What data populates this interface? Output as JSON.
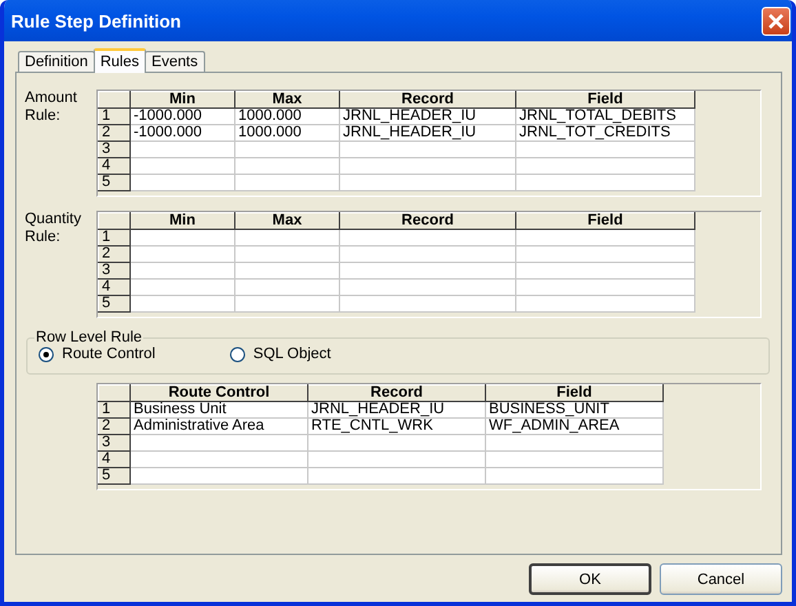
{
  "window": {
    "title": "Rule Step Definition"
  },
  "tabs": [
    {
      "label": "Definition",
      "selected": false
    },
    {
      "label": "Rules",
      "selected": true
    },
    {
      "label": "Events",
      "selected": false
    }
  ],
  "amount_rule": {
    "label": "Amount Rule:",
    "columns": [
      "Min",
      "Max",
      "Record",
      "Field"
    ],
    "rows": [
      {
        "number": "1",
        "cells": [
          "-1000.000",
          "1000.000",
          "JRNL_HEADER_IU",
          "JRNL_TOTAL_DEBITS"
        ]
      },
      {
        "number": "2",
        "cells": [
          "-1000.000",
          "1000.000",
          "JRNL_HEADER_IU",
          "JRNL_TOT_CREDITS"
        ]
      },
      {
        "number": "3"
      },
      {
        "number": "4"
      },
      {
        "number": "5"
      }
    ]
  },
  "quantity_rule": {
    "label": "Quantity Rule:",
    "columns": [
      "Min",
      "Max",
      "Record",
      "Field"
    ],
    "rows": [
      {
        "number": "1"
      },
      {
        "number": "2"
      },
      {
        "number": "3"
      },
      {
        "number": "4"
      },
      {
        "number": "5"
      }
    ]
  },
  "row_level_rule": {
    "title": "Row Level Rule",
    "options": [
      {
        "label": "Route Control",
        "selected": true
      },
      {
        "label": "SQL Object",
        "selected": false
      }
    ]
  },
  "route_control": {
    "columns": [
      "Route Control",
      "Record",
      "Field"
    ],
    "rows": [
      {
        "number": "1",
        "cells": [
          "Business Unit",
          "JRNL_HEADER_IU",
          "BUSINESS_UNIT"
        ]
      },
      {
        "number": "2",
        "cells": [
          "Administrative Area",
          "RTE_CNTL_WRK",
          "WF_ADMIN_AREA"
        ]
      },
      {
        "number": "3"
      },
      {
        "number": "4"
      },
      {
        "number": "5"
      }
    ]
  },
  "buttons": [
    {
      "label": "OK",
      "default": true
    },
    {
      "label": "Cancel",
      "default": false
    }
  ]
}
